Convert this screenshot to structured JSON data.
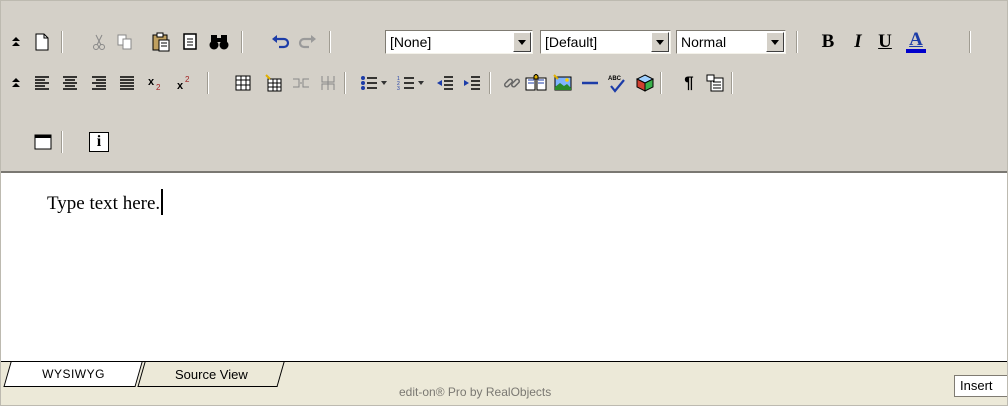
{
  "toolbar": {
    "font_name": {
      "selected": "[None]"
    },
    "font_size": {
      "selected": "[Default]"
    },
    "paragraph_style": {
      "selected": "Normal"
    },
    "bold_glyph": "B",
    "italic_glyph": "I",
    "underline_glyph": "U",
    "font_color_glyph": "A",
    "font_color_bar": "#0000cc",
    "paragraph_mark_glyph": "¶",
    "info_glyph": "i"
  },
  "editor": {
    "content_text": "Type text here."
  },
  "statusbar": {
    "tabs": [
      {
        "label": "WYSIWYG",
        "active": true
      },
      {
        "label": "Source View",
        "active": false
      }
    ],
    "brand": "edit-on® Pro by RealObjects",
    "mode": "Insert"
  }
}
